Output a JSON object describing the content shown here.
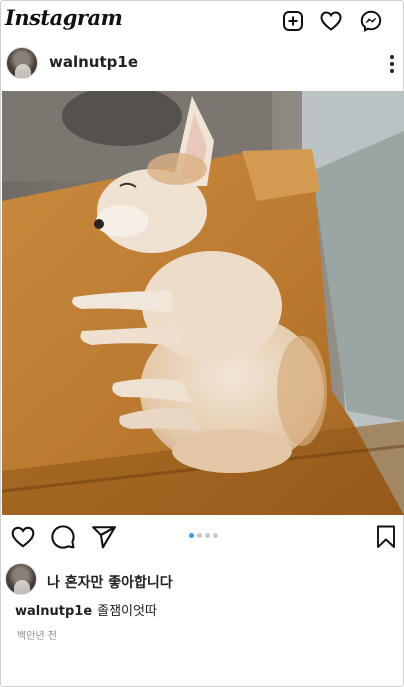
{
  "app": {
    "logo_text": "Instagram"
  },
  "topbar": {
    "icons": [
      "new-post-icon",
      "activity-heart-icon",
      "messenger-icon"
    ]
  },
  "post": {
    "username": "walnutp1e",
    "more_icon": "more-options-icon",
    "photo_alt": "sleeping puppy on wooden chair",
    "carousel": {
      "count": 4,
      "active_index": 0
    },
    "liked_by": "나 혼자만 좋아합니다",
    "caption_user": "walnutp1e",
    "caption_text": "졸잼이엇따",
    "timestamp": "백만년 전"
  },
  "colors": {
    "accent": "#3897f0",
    "muted": "#8e8e8e",
    "text": "#222222"
  }
}
